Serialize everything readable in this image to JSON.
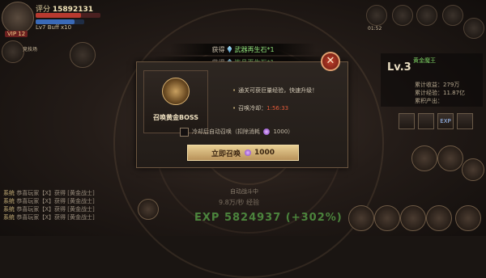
{
  "hud": {
    "power_prefix": "评分",
    "power_value": "15892131",
    "level_text": "Lv7   Buff x10",
    "vip": "VIP 12",
    "left_icon_label": "竞技场",
    "right_top_label": "01:52"
  },
  "notices": [
    {
      "prefix": "获得",
      "item": "武器再生石*1"
    },
    {
      "prefix": "获得",
      "item": "饰品再生石*1"
    }
  ],
  "dialog": {
    "boss_name": "召唤黄金BOSS",
    "info_lines": [
      {
        "text": "通关可获巨量经验，快速升级！",
        "value": ""
      },
      {
        "text": "召唤冷却：",
        "value": "1:56:33"
      }
    ],
    "checkbox_label": "冷却后自动召唤（扣除消耗",
    "checkbox_cost": "1000）",
    "checkbox_checked": false,
    "button_label": "立即召唤",
    "button_cost": "1000",
    "close_symbol": "✕"
  },
  "right_panel": {
    "level": "Lv.3",
    "lines": [
      "累计收益：279万",
      "累计经验：11.87亿",
      "累积产出："
    ],
    "green_text": "黄金魔王",
    "exp_button": "EXP"
  },
  "chat": [
    {
      "tag": "系统",
      "text": "恭喜玩家【X】获得 [黄金战士]"
    },
    {
      "tag": "系统",
      "text": "恭喜玩家【X】获得 [黄金战士]"
    },
    {
      "tag": "系统",
      "text": "恭喜玩家【X】获得 [黄金战士]"
    },
    {
      "tag": "系统",
      "text": "恭喜玩家【X】获得 [黄金战士]"
    }
  ],
  "bottom": {
    "auto_label": "自动战斗中",
    "mid_text": "9.8万/秒 经验",
    "big_text": "EXP 5824937 (+302%)",
    "exp_line": "EXP 5824937 (+302%)"
  }
}
